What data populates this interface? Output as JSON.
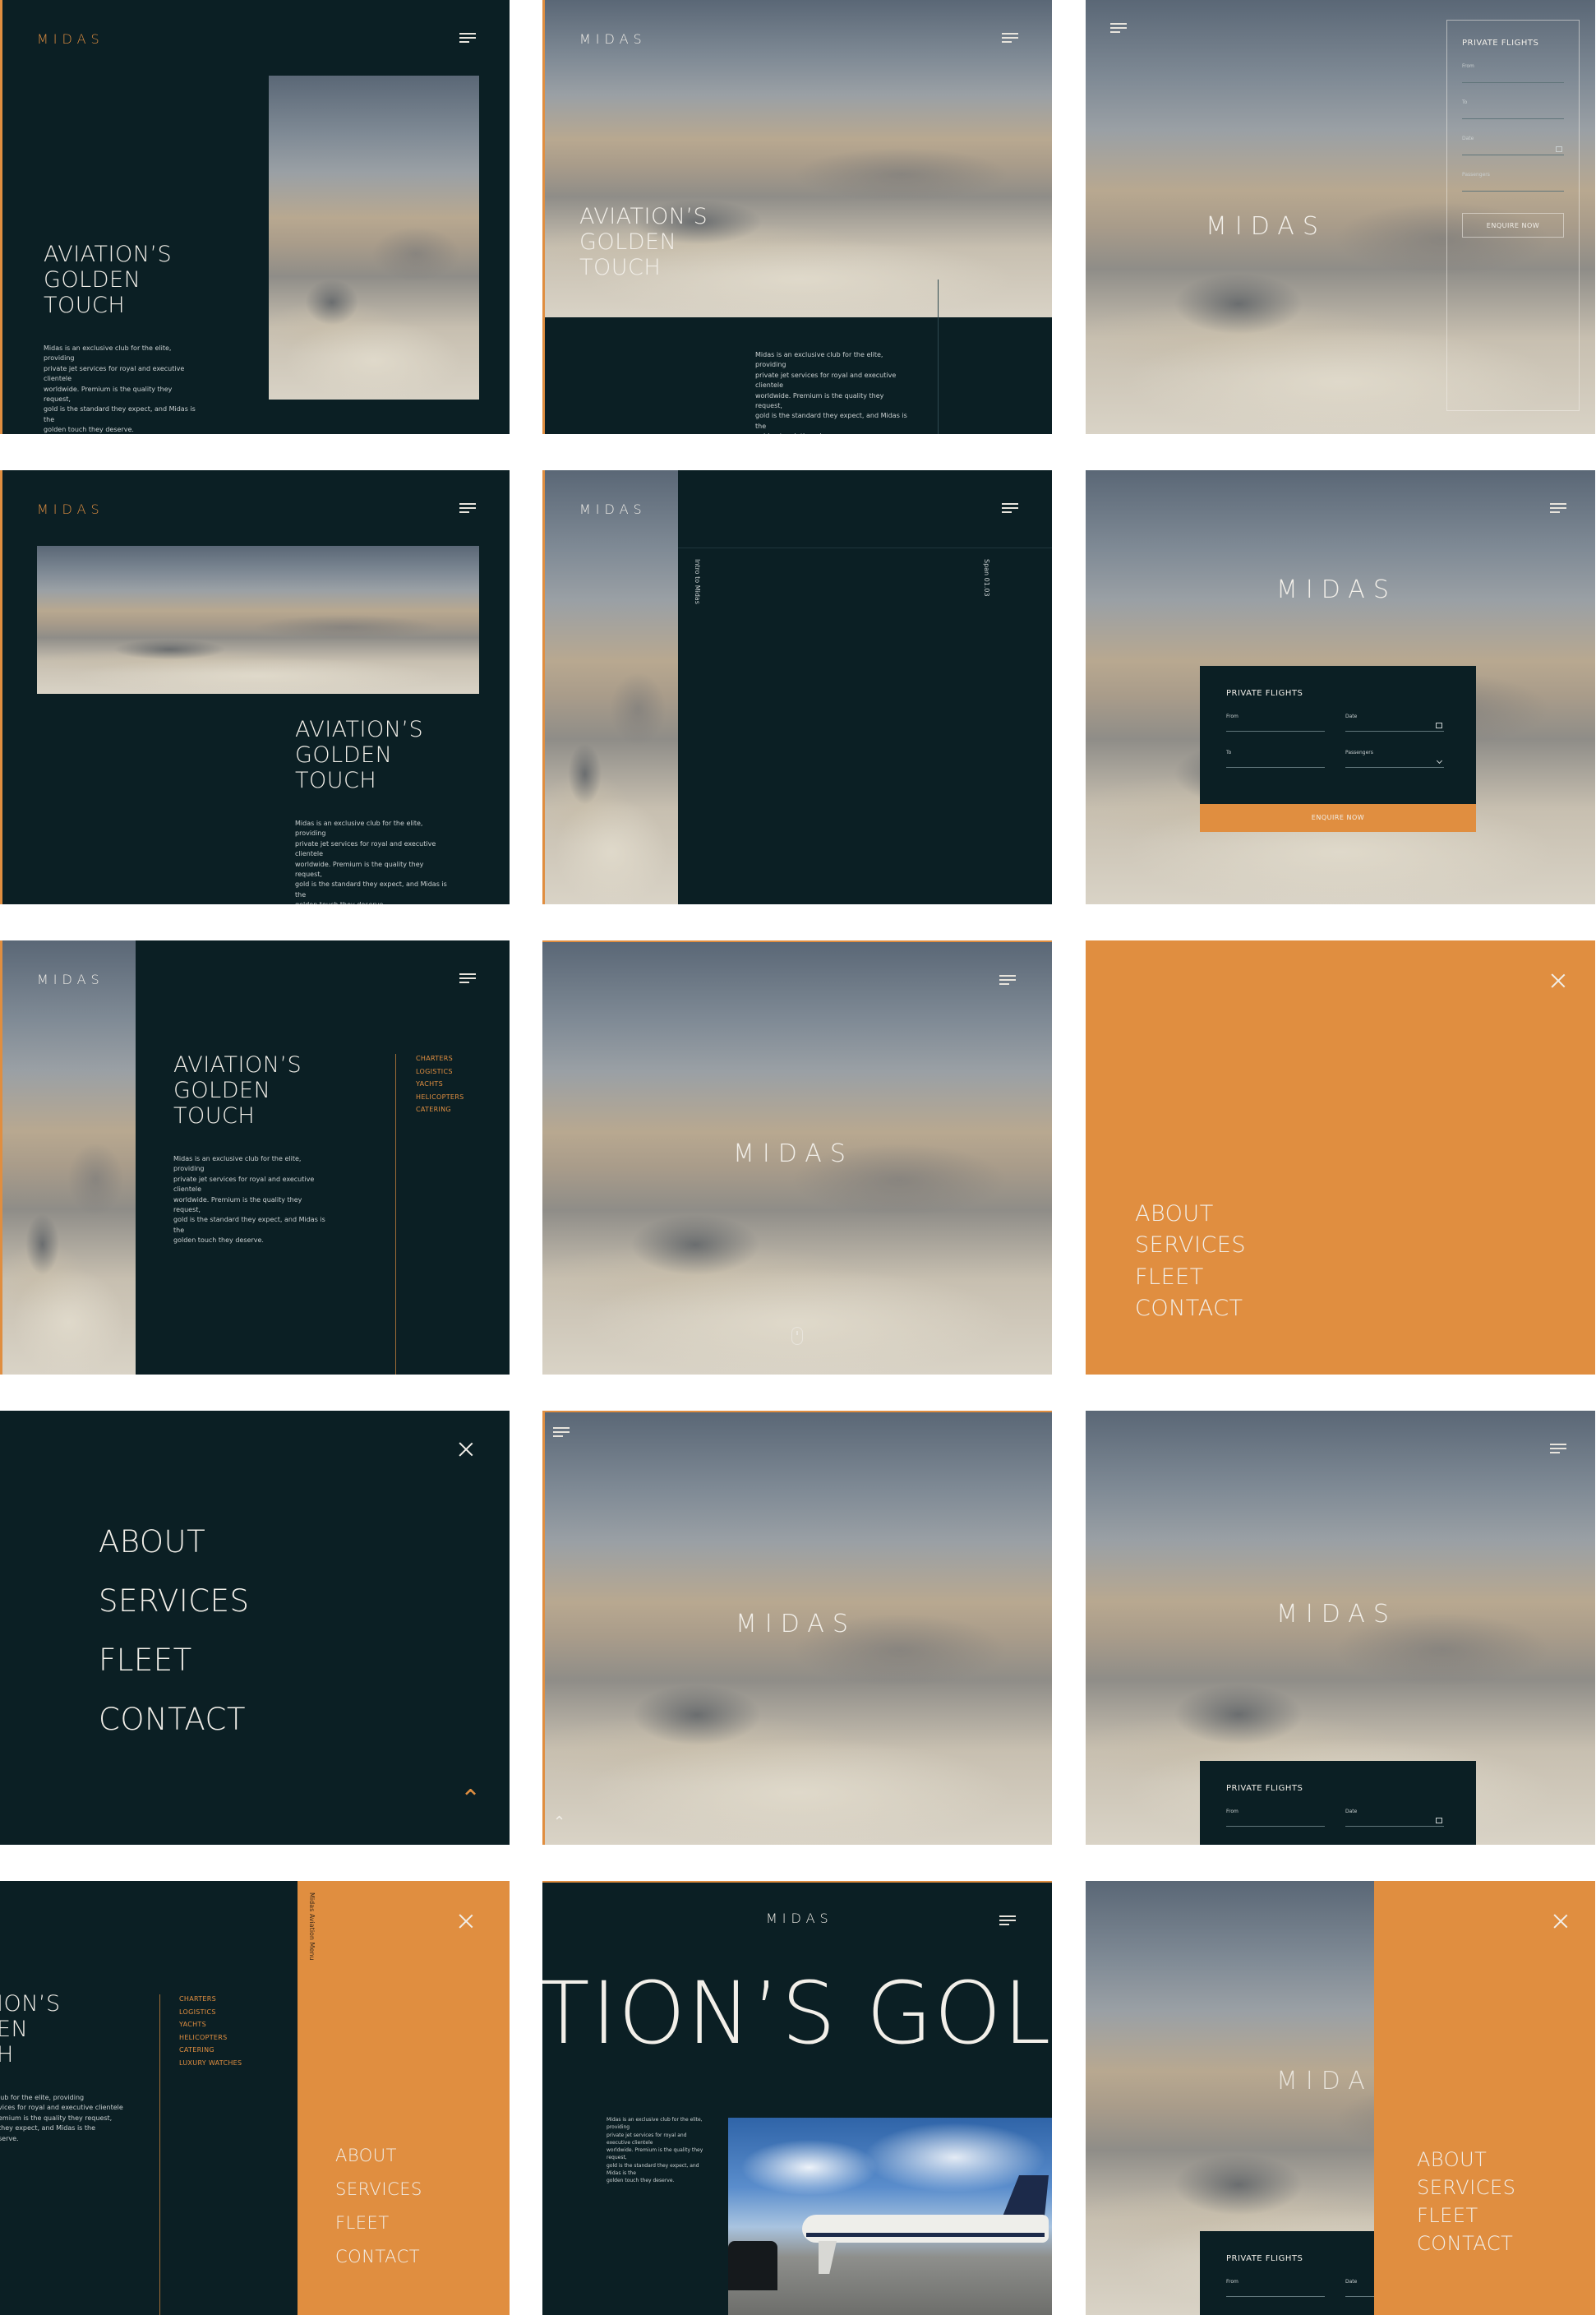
{
  "brand": {
    "logo": "MIDAS",
    "colors": {
      "navy": "#0b1f24",
      "orange": "#e08e40",
      "cream": "#f2efe9"
    }
  },
  "hero": {
    "headline": [
      "AVIATION’S",
      "GOLDEN",
      "TOUCH"
    ],
    "paragraph": [
      "Midas is an exclusive club for the elite, providing",
      "private jet services for royal and executive clientele",
      "worldwide. Premium is the quality they request,",
      "gold is the standard they expect, and Midas is the",
      "golden touch they deserve."
    ],
    "paragraph_b": [
      "Midas is an exclusive club for the elite, providing",
      "private jet services for royal and executive clientele",
      "worldwide. Premium is the quality they request,",
      "gold is the standard they expect, and Midas is the",
      "golden touch they deserve."
    ]
  },
  "menu": {
    "items": [
      "ABOUT",
      "SERVICES",
      "FLEET",
      "CONTACT"
    ]
  },
  "services": {
    "items": [
      "CHARTERS",
      "LOGISTICS",
      "YACHTS",
      "HELICOPTERS",
      "CATERING"
    ],
    "items_extended": [
      "CHARTERS",
      "LOGISTICS",
      "YACHTS",
      "HELICOPTERS",
      "CATERING",
      "LUXURY WATCHES"
    ]
  },
  "form": {
    "title": "PRIVATE FLIGHTS",
    "from_label": "From",
    "to_label": "To",
    "date_label": "Date",
    "passengers_label": "Passengers",
    "cta": "ENQUIRE NOW"
  },
  "sidebar": {
    "left_text": "Intro to Midas",
    "right_text": "Span 01.03",
    "menu_vertical": "Midas Aviation Menu"
  },
  "marquee": {
    "text": "TION’S GOLD"
  },
  "hero_cropped": {
    "headline": [
      "ION’S",
      "EN",
      "H"
    ],
    "paragraph": [
      "lub for the elite, providing",
      "vices for royal and executive clientele",
      "emium is the quality they request,",
      "they expect, and Midas is the",
      "serve."
    ]
  },
  "icons": [
    "hamburger-icon",
    "close-icon",
    "calendar-icon",
    "chevron-down-icon",
    "scroll-mouse-icon",
    "midas-glyph-icon"
  ]
}
